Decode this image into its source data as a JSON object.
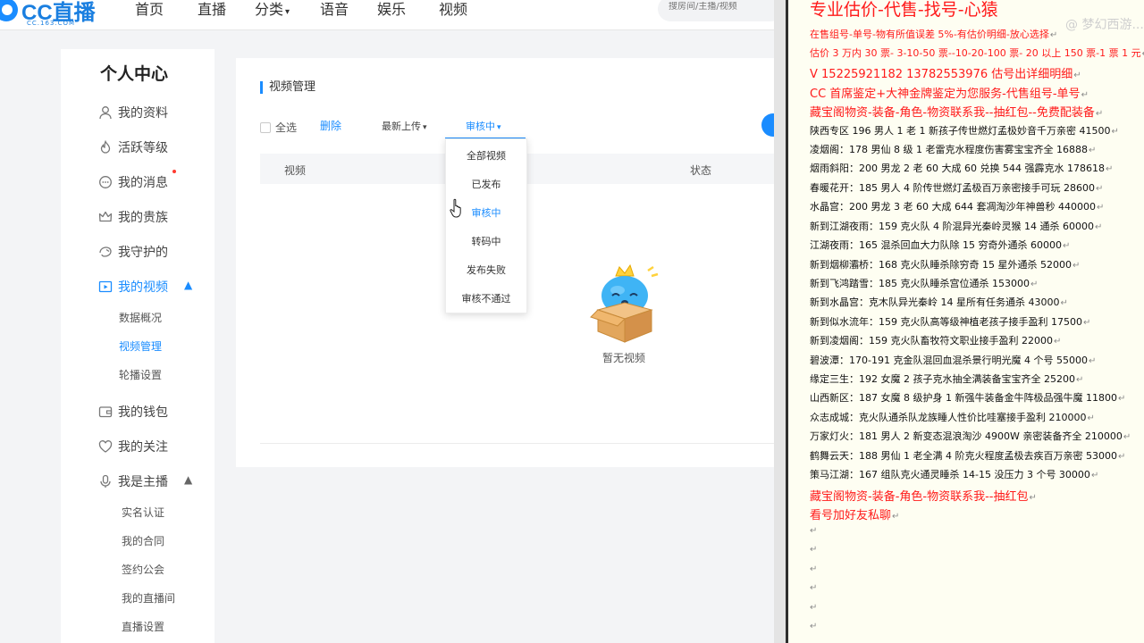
{
  "nav": {
    "logo_text": "CC直播",
    "logo_sub": "CC.163.COM",
    "items": [
      "首页",
      "直播",
      "分类",
      "语音",
      "娱乐",
      "视频"
    ],
    "search_placeholder": "搜房间/主播/视频"
  },
  "sidebar": {
    "title": "个人中心",
    "items": [
      {
        "label": "我的资料",
        "icon": "user-icon"
      },
      {
        "label": "活跃等级",
        "icon": "flame-icon"
      },
      {
        "label": "我的消息",
        "icon": "message-icon"
      },
      {
        "label": "我的贵族",
        "icon": "crown-icon"
      },
      {
        "label": "我守护的",
        "icon": "guard-icon"
      },
      {
        "label": "我的视频",
        "icon": "video-icon"
      },
      {
        "label": "我的钱包",
        "icon": "wallet-icon"
      },
      {
        "label": "我的关注",
        "icon": "heart-icon"
      },
      {
        "label": "我是主播",
        "icon": "mic-icon"
      }
    ],
    "video_sub": [
      "数据概况",
      "视频管理",
      "轮播设置"
    ],
    "anchor_sub": [
      "实名认证",
      "我的合同",
      "签约公会",
      "我的直播间",
      "直播设置"
    ]
  },
  "main": {
    "title": "视频管理",
    "select_all": "全选",
    "delete": "删除",
    "sort": "最新上传",
    "status_filter": "审核中",
    "col_video": "视频",
    "col_status": "状态",
    "empty": "暂无视频"
  },
  "dropdown": {
    "options": [
      "全部视频",
      "已发布",
      "审核中",
      "转码中",
      "发布失败",
      "审核不通过"
    ]
  },
  "doc": {
    "title": "专业估价-代售-找号-心猿",
    "watermark": "@ 梦幻西游...",
    "lines": [
      "在售组号-单号-物有所值误差 5%-有估价明细-放心选择",
      "估价 3 万内 30 票- 3-10-50 票--10-20-100 票- 20 以上 150 票-1 票 1 元",
      "V 15225921182      13782553976   估号出详细明细",
      "CC 首席鉴定+大神金牌鉴定为您服务-代售组号-单号",
      "藏宝阁物资-装备-角色-物资联系我--抽红包--免费配装备",
      "陕西专区 196 男人 1 老 1 新孩子传世燃灯孟极妙音千万亲密 41500",
      "凌烟阁：178 男仙 8 级 1 老雷克水程度伤害雾宝宝齐全 16888",
      "烟雨斜阳：200 男龙 2 老 60 大成 60 兑换 544 强霹克水 178618",
      "春暖花开：185 男人 4 阶传世燃灯孟极百万亲密接手可玩 28600",
      "水晶宫：200 男龙 3 老 60 大成 644 套凋淘沙年神兽秒 440000",
      "新到江湖夜雨：159 克火队 4 阶混异光秦岭灵猴 14 通杀 60000",
      "江湖夜雨：165 混杀回血大力队除 15 穷奇外通杀 60000",
      "新到烟柳灞桥：168 克火队睡杀除穷奇 15 星外通杀 52000",
      "新到飞鸿踏雪：185 克火队睡杀宫位通杀 153000",
      "新到水晶宫：克木队异光秦岭 14 星所有任务通杀 43000",
      "新到似水流年：159 克火队高等级神植老孩子接手盈利 17500",
      "新到凌烟阁：159 克火队畜牧符文职业接手盈利 22000",
      "碧波潭：170-191 克金队混回血混杀景行明光魔 4 个号 55000",
      "缘定三生：192 女魔 2 孩子克水抽全满装备宝宝齐全 25200",
      "山西新区：187 女魔 8 级护身 1 新强牛装备金牛阵极品强牛魔 11800",
      "众志成城：克火队通杀队龙族睡人性价比哇塞接手盈利 210000",
      "万家灯火：181 男人 2 新变态混浪淘沙 4900W 亲密装备齐全 210000",
      "鹤舞云天：188 男仙 1 老全满 4 阶克火程度孟极去疾百万亲密 53000",
      "策马江湖：167 组队克火通灵睡杀 14-15 没压力 3 个号 30000",
      "藏宝阁物资-装备-角色-物资联系我--抽红包",
      "看号加好友私聊"
    ]
  }
}
